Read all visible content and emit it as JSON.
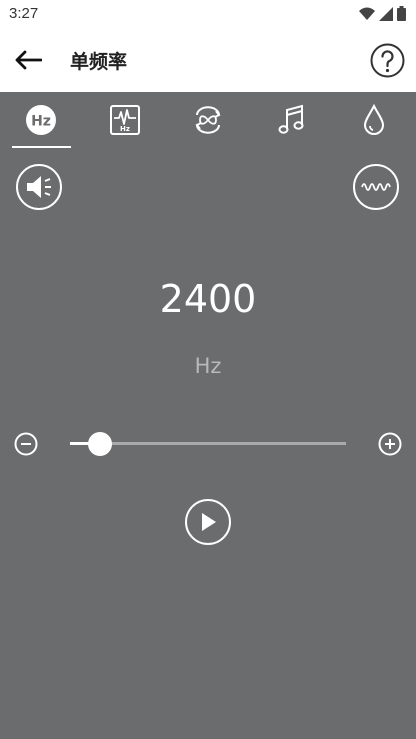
{
  "status_bar": {
    "time": "3:27",
    "icons": [
      "wifi-icon",
      "signal-icon",
      "battery-icon"
    ]
  },
  "app_bar": {
    "title": "单频率",
    "back_icon": "arrow-left-icon",
    "help_icon": "question-circle-icon"
  },
  "tabs": [
    {
      "id": "hz",
      "icon": "hz-circle-icon",
      "selected": true
    },
    {
      "id": "sweep",
      "icon": "waveform-hz-icon",
      "selected": false
    },
    {
      "id": "loop",
      "icon": "loop-icon",
      "selected": false
    },
    {
      "id": "music",
      "icon": "music-note-icon",
      "selected": false
    },
    {
      "id": "water",
      "icon": "water-drop-icon",
      "selected": false
    }
  ],
  "controls": {
    "volume_icon": "speaker-icon",
    "wave_icon": "sine-wave-icon"
  },
  "frequency": {
    "value": "2400",
    "unit": "Hz",
    "slider_position": 0.11
  },
  "playback": {
    "play_icon": "play-icon"
  },
  "colors": {
    "background": "#6b6c6e",
    "foreground": "#ffffff",
    "unit_text": "#b8b9bb",
    "track": "#a9aaac"
  }
}
